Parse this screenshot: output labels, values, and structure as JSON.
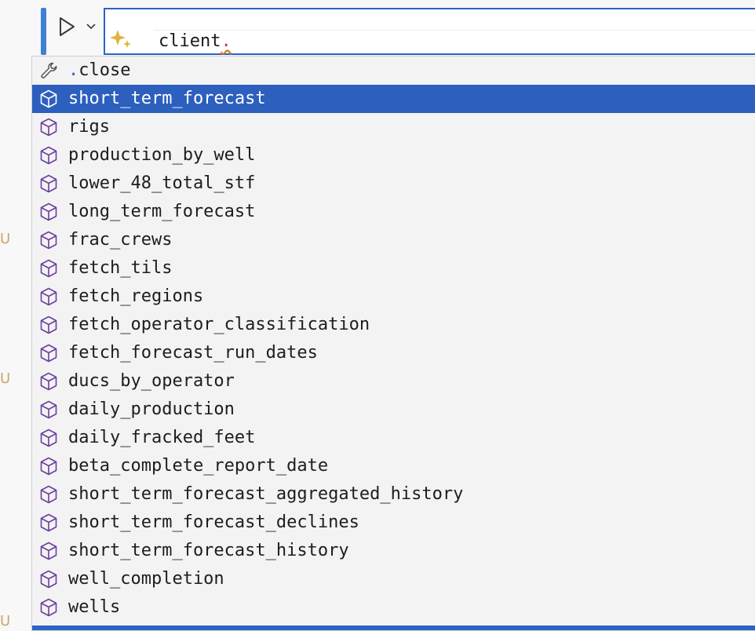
{
  "gutter": {
    "marks": [
      "U",
      "U",
      "U"
    ]
  },
  "editor": {
    "code_text": "client",
    "code_dot": "."
  },
  "suggestions": {
    "keyword_item": {
      "dot": ".",
      "label": "close",
      "icon": "wrench-icon"
    },
    "selected_index": 0,
    "items": [
      {
        "label": "short_term_forecast",
        "icon": "cube-icon"
      },
      {
        "label": "rigs",
        "icon": "cube-icon"
      },
      {
        "label": "production_by_well",
        "icon": "cube-icon"
      },
      {
        "label": "lower_48_total_stf",
        "icon": "cube-icon"
      },
      {
        "label": "long_term_forecast",
        "icon": "cube-icon"
      },
      {
        "label": "frac_crews",
        "icon": "cube-icon"
      },
      {
        "label": "fetch_tils",
        "icon": "cube-icon"
      },
      {
        "label": "fetch_regions",
        "icon": "cube-icon"
      },
      {
        "label": "fetch_operator_classification",
        "icon": "cube-icon"
      },
      {
        "label": "fetch_forecast_run_dates",
        "icon": "cube-icon"
      },
      {
        "label": "ducs_by_operator",
        "icon": "cube-icon"
      },
      {
        "label": "daily_production",
        "icon": "cube-icon"
      },
      {
        "label": "daily_fracked_feet",
        "icon": "cube-icon"
      },
      {
        "label": "beta_complete_report_date",
        "icon": "cube-icon"
      },
      {
        "label": "short_term_forecast_aggregated_history",
        "icon": "cube-icon"
      },
      {
        "label": "short_term_forecast_declines",
        "icon": "cube-icon"
      },
      {
        "label": "short_term_forecast_history",
        "icon": "cube-icon"
      },
      {
        "label": "well_completion",
        "icon": "cube-icon"
      },
      {
        "label": "wells",
        "icon": "cube-icon"
      }
    ]
  },
  "colors": {
    "accent": "#2c63c5",
    "selection": "#2c5fbe",
    "cube": "#6b3fa0",
    "sparkle": "#e2b23a",
    "gutter_mark": "#c9a86a"
  }
}
